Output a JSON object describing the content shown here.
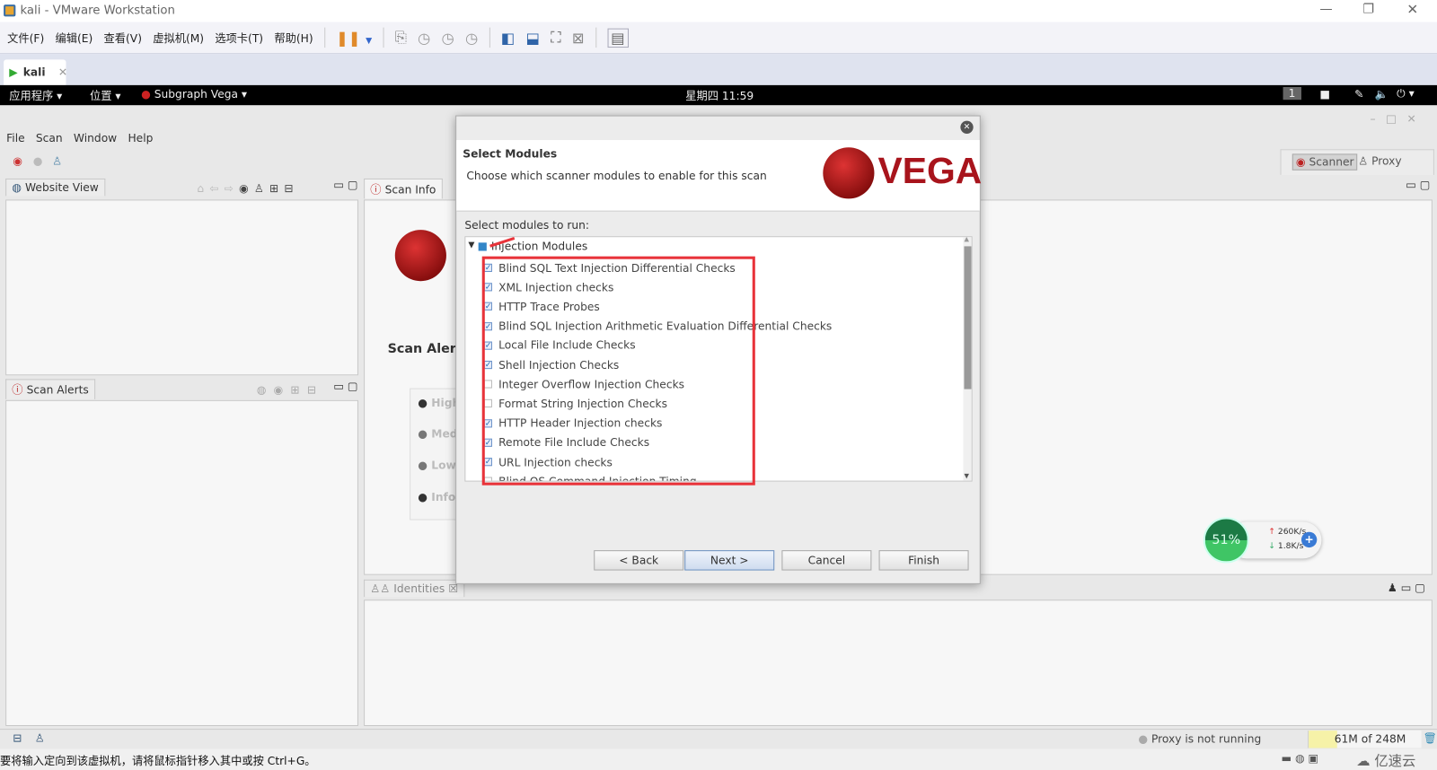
{
  "window": {
    "title": "kali - VMware Workstation",
    "vm_tab": "kali"
  },
  "vmware_menu": [
    "文件(F)",
    "编辑(E)",
    "查看(V)",
    "虚拟机(M)",
    "选项卡(T)",
    "帮助(H)"
  ],
  "gnome": {
    "applications": "应用程序",
    "places": "位置",
    "app_name": "Subgraph Vega",
    "clock": "星期四 11:59",
    "workspace": "1"
  },
  "vega": {
    "menu": [
      "File",
      "Scan",
      "Window",
      "Help"
    ],
    "perspectives": {
      "scanner": "Scanner",
      "proxy": "Proxy"
    },
    "tabs": {
      "website_view": "Website View",
      "scan_info": "Scan Info",
      "scan_alerts": "Scan Alerts",
      "identities": "Identities"
    },
    "scan_info": {
      "heading": "Scan Alert",
      "levels": [
        "High",
        "Med",
        "Low",
        "Info"
      ]
    },
    "status": {
      "proxy": "Proxy is not running",
      "memory": "61M of 248M",
      "memory_used_fraction": 0.25
    }
  },
  "dialog": {
    "title": "Select Modules",
    "subtitle": "Choose which scanner modules to enable for this scan",
    "logo_text": "VEGA",
    "prompt": "Select modules to run:",
    "group": {
      "label": "Injection Modules",
      "state": "partial"
    },
    "modules": [
      {
        "label": "Blind SQL Text Injection Differential Checks",
        "checked": true
      },
      {
        "label": "XML Injection checks",
        "checked": true
      },
      {
        "label": "HTTP Trace Probes",
        "checked": true
      },
      {
        "label": "Blind SQL Injection Arithmetic Evaluation Differential Checks",
        "checked": true
      },
      {
        "label": "Local File Include Checks",
        "checked": true
      },
      {
        "label": "Shell Injection Checks",
        "checked": true
      },
      {
        "label": "Integer Overflow Injection Checks",
        "checked": false
      },
      {
        "label": "Format String Injection Checks",
        "checked": false
      },
      {
        "label": "HTTP Header Injection checks",
        "checked": true
      },
      {
        "label": "Remote File Include Checks",
        "checked": true
      },
      {
        "label": "URL Injection checks",
        "checked": true
      },
      {
        "label": "Blind OS Command Injection Timing",
        "checked": false
      }
    ],
    "buttons": {
      "back": "< Back",
      "next": "Next >",
      "cancel": "Cancel",
      "finish": "Finish"
    },
    "annotation_color": "#e8333a"
  },
  "net_widget": {
    "percent": "51%",
    "up": "260K/s",
    "down": "1.8K/s"
  },
  "host_status": "要将输入定向到该虚拟机，请将鼠标指针移入其中或按 Ctrl+G。",
  "watermark": "亿速云"
}
